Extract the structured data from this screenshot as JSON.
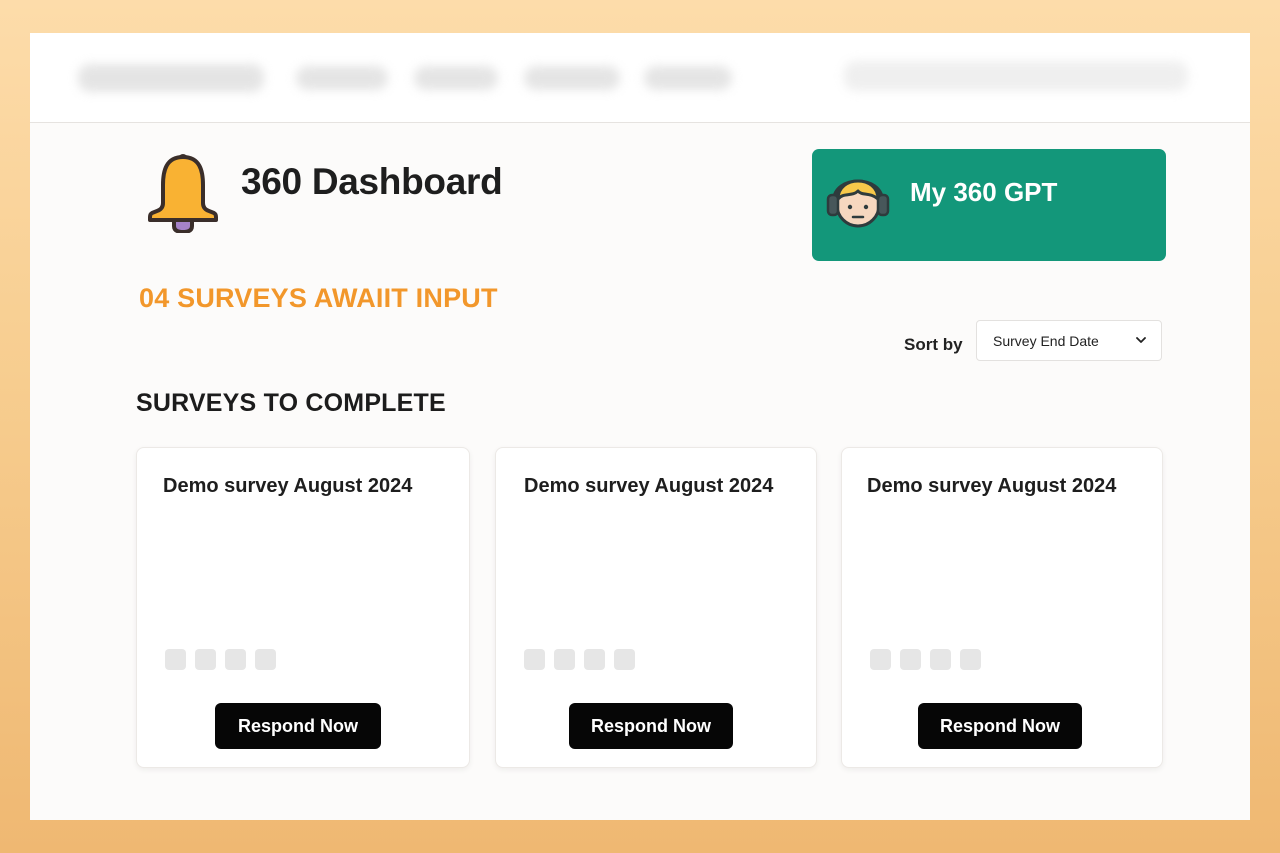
{
  "colors": {
    "accent_orange": "#f2972b",
    "gpt_green": "#13977a",
    "bell_yellow": "#f9b233",
    "button_black": "#060606",
    "background_orange": "#f7cd8f"
  },
  "header": {
    "title": "360 Dashboard",
    "icon": "bell-icon"
  },
  "gpt_card": {
    "label": "My 360 GPT",
    "icon": "support-agent-avatar-icon"
  },
  "await_heading": "04 SURVEYS AWAIIT INPUT",
  "sort": {
    "label": "Sort by",
    "selected": "Survey End Date",
    "icon": "chevron-down-icon"
  },
  "section_heading": "SURVEYS TO COMPLETE",
  "surveys": [
    {
      "title": "Demo survey August 2024",
      "button": "Respond Now"
    },
    {
      "title": "Demo survey August 2024",
      "button": "Respond Now"
    },
    {
      "title": "Demo survey August 2024",
      "button": "Respond Now"
    }
  ]
}
